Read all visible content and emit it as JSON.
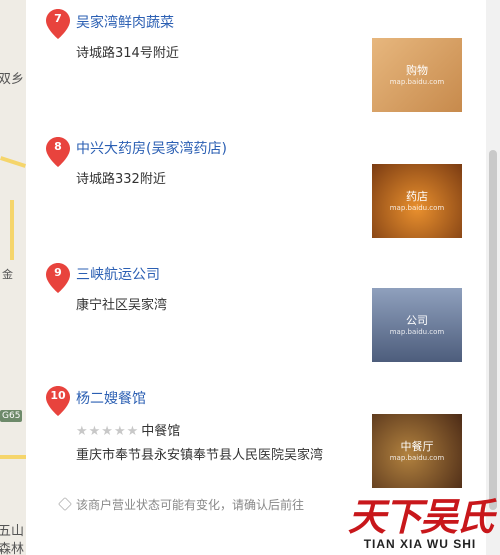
{
  "map": {
    "label_shuang": "双乡",
    "label_jin": "金",
    "badge_g65": "G65",
    "label_wu": "五山",
    "label_sen": "森林"
  },
  "results": [
    {
      "number": "7",
      "title": "吴家湾鲜肉蔬菜",
      "address": "诗城路314号附近",
      "thumb_caption": "购物",
      "thumb_sub": "map.baidu.com"
    },
    {
      "number": "8",
      "title": "中兴大药房(吴家湾药店)",
      "address": "诗城路332附近",
      "thumb_caption": "药店",
      "thumb_sub": "map.baidu.com"
    },
    {
      "number": "9",
      "title": "三峡航运公司",
      "address": "康宁社区吴家湾",
      "thumb_caption": "公司",
      "thumb_sub": "map.baidu.com"
    },
    {
      "number": "10",
      "title": "杨二嫂餐馆",
      "stars": "★★★★★",
      "category": "中餐馆",
      "address": "重庆市奉节县永安镇奉节县人民医院吴家湾",
      "thumb_caption": "中餐厅",
      "thumb_sub": "map.baidu.com",
      "note": "该商户营业状态可能有变化，请确认后前往"
    }
  ],
  "watermark": {
    "cn": "天下吴氏",
    "en": "TIAN XIA WU SHI"
  },
  "colors": {
    "pin": "#e8433d",
    "title": "#2b5fb3",
    "watermark": "#c8171b"
  }
}
